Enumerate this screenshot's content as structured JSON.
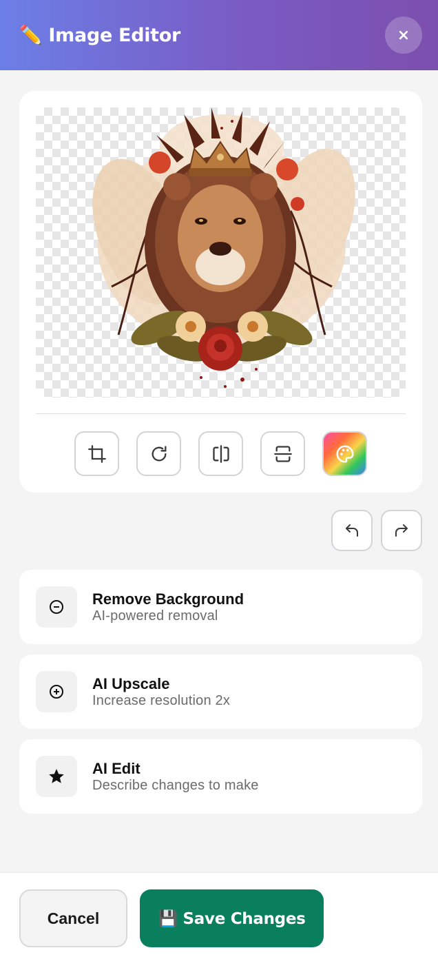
{
  "header": {
    "title": "✏️ Image Editor",
    "close_label": "×"
  },
  "preview": {
    "image_subject": "lion-with-crown-illustration",
    "background": "transparent-checkerboard"
  },
  "tools": [
    {
      "icon": "crop-icon"
    },
    {
      "icon": "rotate-icon"
    },
    {
      "icon": "flip-horizontal-icon"
    },
    {
      "icon": "flip-vertical-icon"
    },
    {
      "icon": "palette-icon"
    }
  ],
  "history": {
    "undo_icon": "undo-icon",
    "redo_icon": "redo-icon"
  },
  "actions": [
    {
      "title": "Remove Background",
      "subtitle": "AI-powered removal",
      "icon": "minus-circle-icon"
    },
    {
      "title": "AI Upscale",
      "subtitle": "Increase resolution 2x",
      "icon": "plus-circle-icon"
    },
    {
      "title": "AI Edit",
      "subtitle": "Describe changes to make",
      "icon": "star-icon"
    }
  ],
  "footer": {
    "cancel_label": "Cancel",
    "save_label": "💾 Save Changes"
  },
  "colors": {
    "header_gradient_start": "#6b7fe6",
    "header_gradient_end": "#7b4fad",
    "save_button": "#0a7f5e",
    "background": "#f4f4f5"
  }
}
